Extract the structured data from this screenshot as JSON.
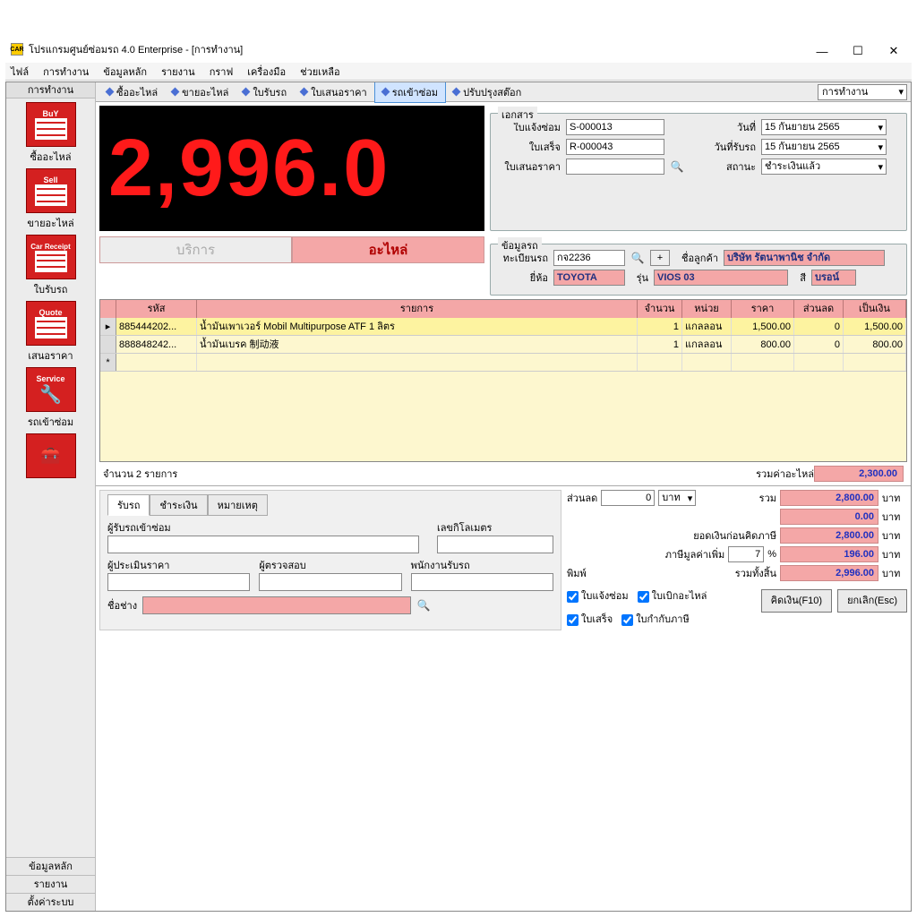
{
  "window": {
    "title": "โปรแกรมศูนย์ซ่อมรถ 4.0 Enterprise - [การทำงาน]",
    "icon_text": "CAR"
  },
  "menubar": [
    "ไฟล์",
    "การทำงาน",
    "ข้อมูลหลัก",
    "รายงาน",
    "กราฟ",
    "เครื่องมือ",
    "ช่วยเหลือ"
  ],
  "leftnav": {
    "header": "การทำงาน",
    "items": [
      {
        "label": "ซื้ออะไหล่",
        "banner": "BuY"
      },
      {
        "label": "ขายอะไหล่",
        "banner": "Sell"
      },
      {
        "label": "ใบรับรถ",
        "banner": "Car Receipt"
      },
      {
        "label": "เสนอราคา",
        "banner": "Quote"
      },
      {
        "label": "รถเข้าซ่อม",
        "banner": "Service"
      },
      {
        "label": "",
        "banner": ""
      }
    ],
    "bottom": [
      "ข้อมูลหลัก",
      "รายงาน",
      "ตั้งค่าระบบ"
    ]
  },
  "subtabs": {
    "items": [
      "ซื้ออะไหล่",
      "ขายอะไหล่",
      "ใบรับรถ",
      "ใบเสนอราคา",
      "รถเข้าซ่อม",
      "ปรับปรุงสต๊อก"
    ],
    "active_index": 4,
    "mode": "การทำงาน"
  },
  "big_number": "2,996.0",
  "documents": {
    "group_label": "เอกสาร",
    "repair_label": "ใบแจ้งซ่อม",
    "repair_value": "S-000013",
    "receipt_label": "ใบเสร็จ",
    "receipt_value": "R-000043",
    "quote_label": "ใบเสนอราคา",
    "quote_value": "",
    "date_label": "วันที่",
    "date_value": "15  กันยายน   2565",
    "recv_date_label": "วันที่รับรถ",
    "recv_date_value": "15  กันยายน   2565",
    "status_label": "สถานะ",
    "status_value": "ชำระเงินแล้ว"
  },
  "car": {
    "group_label": "ข้อมูลรถ",
    "plate_label": "ทะเบียนรถ",
    "plate_value": "กจ2236",
    "customer_label": "ชื่อลูกค้า",
    "customer_value": "บริษัท รัตนาพานิช จำกัด",
    "brand_label": "ยี่ห้อ",
    "brand_value": "TOYOTA",
    "model_label": "รุ่น",
    "model_value": "VIOS 03",
    "color_label": "สี",
    "color_value": "บรอน์"
  },
  "detail_tabs": {
    "service": "บริการ",
    "parts": "อะไหล่"
  },
  "grid": {
    "headers": {
      "code": "รหัส",
      "desc": "รายการ",
      "qty": "จำนวน",
      "unit": "หน่วย",
      "price": "ราคา",
      "disc": "ส่วนลด",
      "amount": "เป็นเงิน"
    },
    "rows": [
      {
        "code": "885444202...",
        "desc": "น้ำมันเพาเวอร์ Mobil Multipurpose ATF 1 ลิตร",
        "qty": "1",
        "unit": "แกลลอน",
        "price": "1,500.00",
        "disc": "0",
        "amount": "1,500.00"
      },
      {
        "code": "888848242...",
        "desc": "น้ำมันเบรค 制动液",
        "qty": "1",
        "unit": "แกลลอน",
        "price": "800.00",
        "disc": "0",
        "amount": "800.00"
      }
    ],
    "count_text": "จำนวน 2 รายการ",
    "parts_total_label": "รวมค่าอะไหล่",
    "parts_total": "2,300.00"
  },
  "bottom_tabs": [
    "รับรถ",
    "ชำระเงิน",
    "หมายเหตุ"
  ],
  "receive": {
    "recv_by_label": "ผู้รับรถเข้าซ่อม",
    "odo_label": "เลขกิโลเมตร",
    "assessor_label": "ผู้ประเมินราคา",
    "inspector_label": "ผู้ตรวจสอบ",
    "recv_staff_label": "พนักงานรับรถ",
    "mechanic_label": "ชื่อช่าง",
    "mechanic_value": ""
  },
  "totals": {
    "discount_label": "ส่วนลด",
    "discount_input": "0",
    "discount_unit": "บาท",
    "sum_label": "รวม",
    "sum": "2,800.00",
    "disc_amt": "0.00",
    "pretax_label": "ยอดเงินก่อนคิดภาษี",
    "pretax": "2,800.00",
    "vat_label": "ภาษีมูลค่าเพิ่ม",
    "vat_pct": "7",
    "vat": "196.00",
    "grand_label": "รวมทั้งสิ้น",
    "grand": "2,996.00",
    "currency": "บาท",
    "pct": "%"
  },
  "print": {
    "label": "พิมพ์",
    "repair": "ใบแจ้งซ่อม",
    "withdraw": "ใบเบิกอะไหล่",
    "receipt": "ใบเสร็จ",
    "tax": "ใบกำกับภาษี"
  },
  "buttons": {
    "calc": "คิดเงิน(F10)",
    "cancel": "ยกเลิก(Esc)"
  }
}
